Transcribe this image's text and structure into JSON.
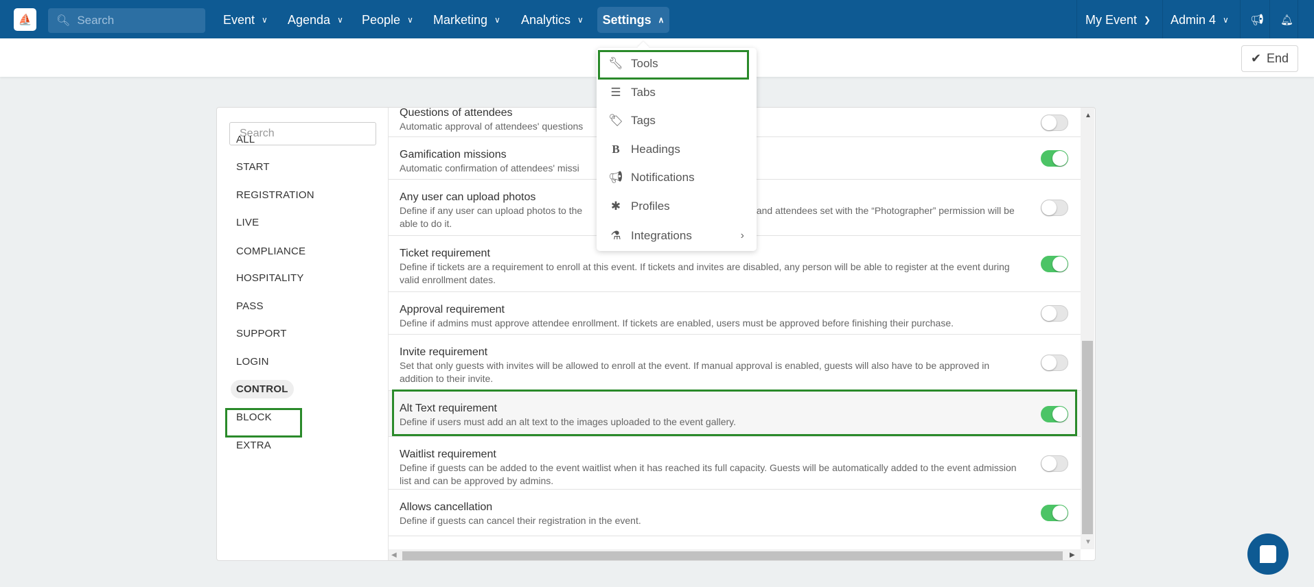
{
  "nav": {
    "search_placeholder": "Search",
    "items": [
      {
        "label": "Event"
      },
      {
        "label": "Agenda"
      },
      {
        "label": "People"
      },
      {
        "label": "Marketing"
      },
      {
        "label": "Analytics"
      },
      {
        "label": "Settings",
        "active": true
      }
    ],
    "my_event": "My Event",
    "admin": "Admin 4",
    "brand_color": "#0e5a93"
  },
  "toolbar": {
    "end_label": "End"
  },
  "sidebar": {
    "search_placeholder": "Search",
    "categories": [
      "ALL",
      "START",
      "REGISTRATION",
      "LIVE",
      "COMPLIANCE",
      "HOSPITALITY",
      "PASS",
      "SUPPORT",
      "LOGIN",
      "CONTROL",
      "BLOCK",
      "EXTRA"
    ],
    "selected": "CONTROL"
  },
  "settings": [
    {
      "title": "Questions of attendees",
      "desc": "Automatic approval of attendees' questions",
      "on": false
    },
    {
      "title": "Gamification missions",
      "desc": "Automatic confirmation of attendees' missi",
      "on": true
    },
    {
      "title": "Any user can upload photos",
      "desc": "Define if any user can upload photos to the",
      "desc2": "ns and attendees set with the “Photographer” permission will be able to do it.",
      "on": false
    },
    {
      "title": "Ticket requirement",
      "desc": "Define if tickets are a requirement to enroll at this event. If tickets and invites are disabled, any person will be able to register at the event during valid enrollment dates.",
      "on": true
    },
    {
      "title": "Approval requirement",
      "desc": "Define if admins must approve attendee enrollment. If tickets are enabled, users must be approved before finishing their purchase.",
      "on": false
    },
    {
      "title": "Invite requirement",
      "desc": "Set that only guests with invites will be allowed to enroll at the event. If manual approval is enabled, guests will also have to be approved in addition to their invite.",
      "on": false
    },
    {
      "title": "Alt Text requirement",
      "desc": "Define if users must add an alt text to the images uploaded to the event gallery.",
      "on": true
    },
    {
      "title": "Waitlist requirement",
      "desc": "Define if guests can be added to the event waitlist when it has reached its full capacity. Guests will be automatically added to the event admission list and can be approved by admins.",
      "on": false
    },
    {
      "title": "Allows cancellation",
      "desc": "Define if guests can cancel their registration in the event.",
      "on": true
    }
  ],
  "settings_menu": [
    {
      "label": "Tools",
      "icon": "wrench"
    },
    {
      "label": "Tabs",
      "icon": "list-check"
    },
    {
      "label": "Tags",
      "icon": "tags"
    },
    {
      "label": "Headings",
      "icon": "bold"
    },
    {
      "label": "Notifications",
      "icon": "megaphone"
    },
    {
      "label": "Profiles",
      "icon": "asterisk"
    },
    {
      "label": "Integrations",
      "icon": "flask"
    }
  ],
  "toggle_on_color": "#4cc466",
  "highlight_color": "#2a8a2a"
}
